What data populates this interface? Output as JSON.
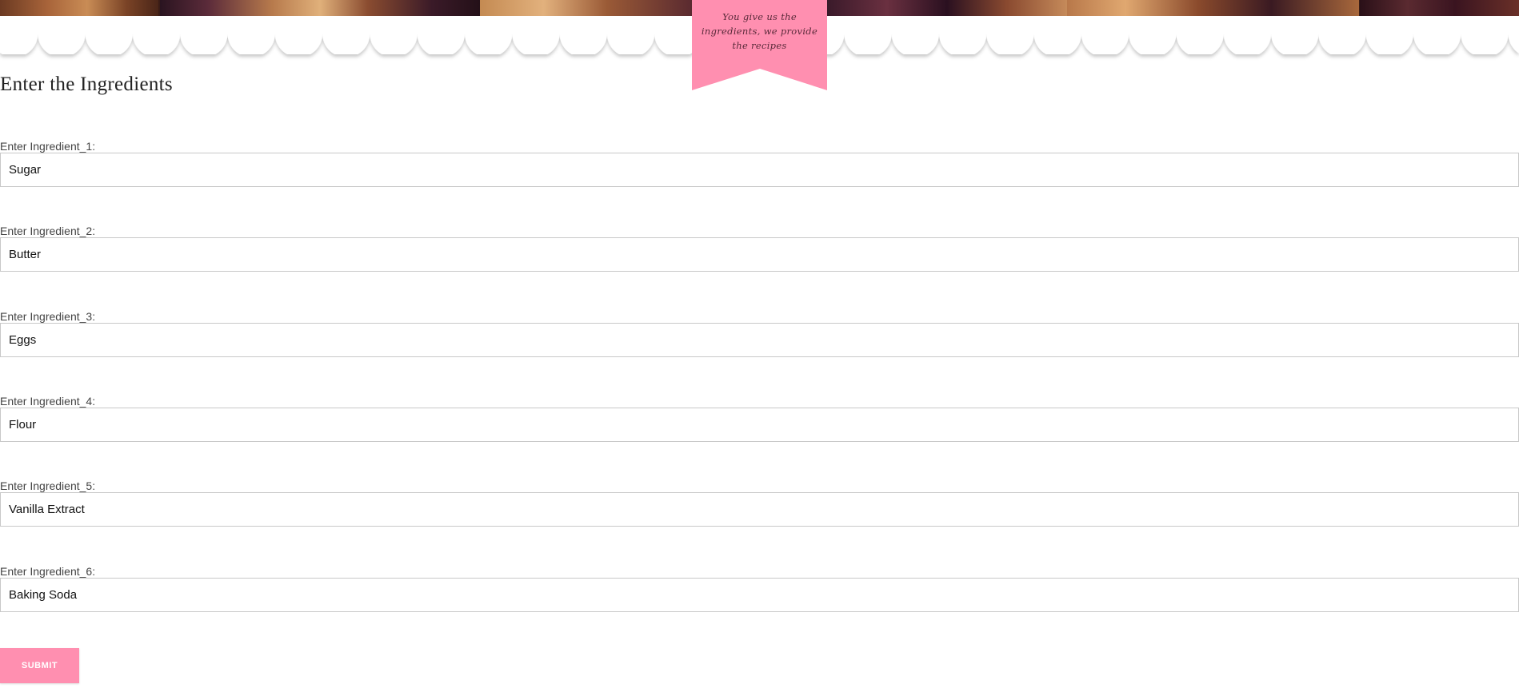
{
  "header": {
    "ribbon_text": "You give us the ingredients, we provide the recipes",
    "accent_color": "#ff8fb0"
  },
  "form": {
    "title": "Enter the Ingredients",
    "fields": [
      {
        "label": "Enter Ingredient_1:",
        "value": "Sugar"
      },
      {
        "label": "Enter Ingredient_2:",
        "value": "Butter"
      },
      {
        "label": "Enter Ingredient_3:",
        "value": "Eggs"
      },
      {
        "label": "Enter Ingredient_4:",
        "value": "Flour"
      },
      {
        "label": "Enter Ingredient_5:",
        "value": "Vanilla Extract"
      },
      {
        "label": "Enter Ingredient_6:",
        "value": "Baking Soda"
      }
    ],
    "submit_label": "SUBMIT"
  }
}
